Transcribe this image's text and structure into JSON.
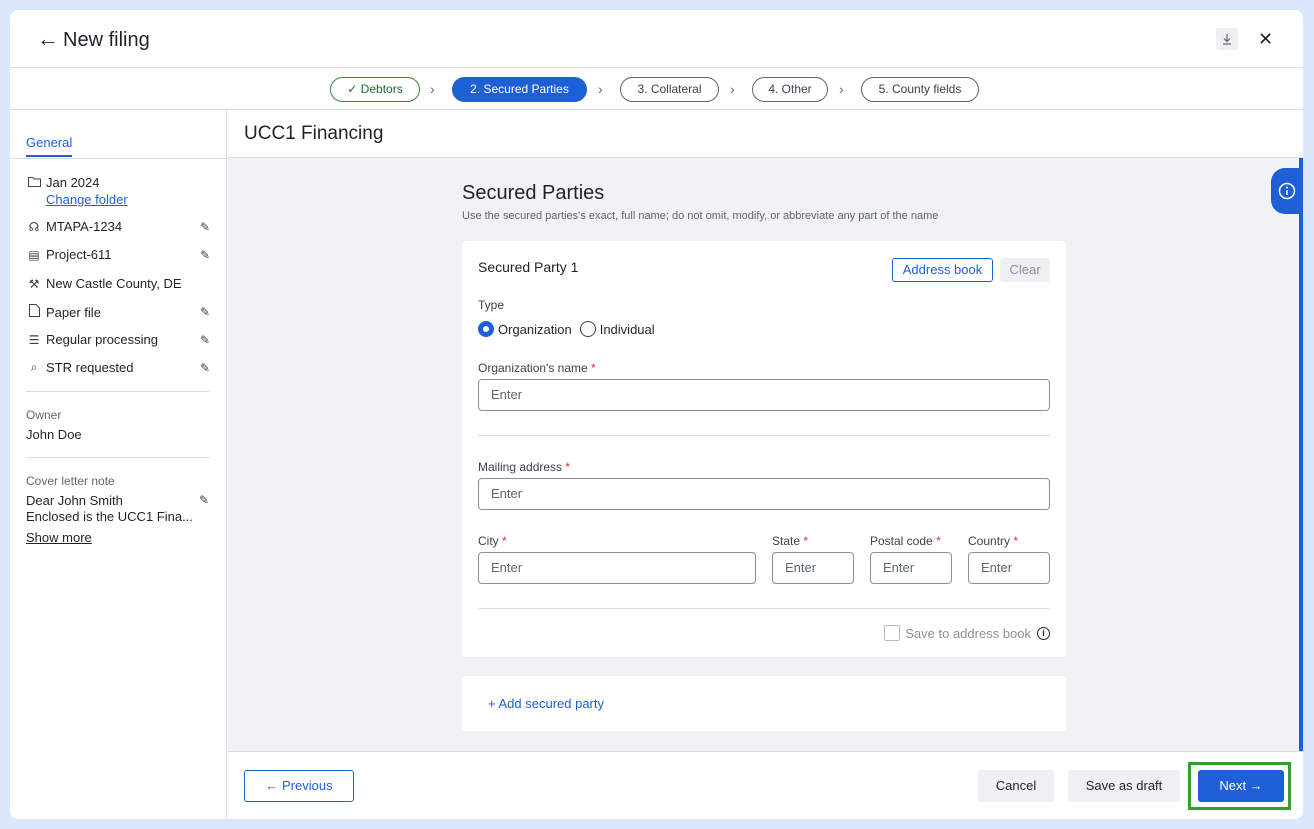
{
  "header": {
    "back_icon": "←",
    "title": "New filing",
    "download_icon": "⤓",
    "close_icon": "✕"
  },
  "stepper": {
    "steps": [
      {
        "label": "✓ Debtors",
        "state": "done"
      },
      {
        "label": "2. Secured Parties",
        "state": "active"
      },
      {
        "label": "3. Collateral",
        "state": "pending"
      },
      {
        "label": "4. Other",
        "state": "pending"
      },
      {
        "label": "5. County fields",
        "state": "pending"
      }
    ],
    "separator": "›"
  },
  "sidebar": {
    "tab": "General",
    "folder": "Jan 2024",
    "change_folder": "Change folder",
    "items": [
      {
        "icon": "headset-icon",
        "label": "MTAPA-1234",
        "editable": true
      },
      {
        "icon": "project-icon",
        "label": "Project-611",
        "editable": true
      },
      {
        "icon": "gavel-icon",
        "label": "New Castle County, DE",
        "editable": false
      },
      {
        "icon": "document-icon",
        "label": "Paper file",
        "editable": true
      },
      {
        "icon": "list-icon",
        "label": "Regular processing",
        "editable": true
      },
      {
        "icon": "search-document-icon",
        "label": "STR requested",
        "editable": true
      }
    ],
    "owner_label": "Owner",
    "owner_value": "John Doe",
    "cover_label": "Cover letter note",
    "cover_line1": "Dear John Smith",
    "cover_line2": "Enclosed is the UCC1 Fina...",
    "show_more": "Show more"
  },
  "main": {
    "title": "UCC1 Financing",
    "section_title": "Secured Parties",
    "section_subtitle": "Use the secured parties's exact, full name; do not omit, modify, or abbreviate any part of the name",
    "card": {
      "title": "Secured Party 1",
      "address_book": "Address book",
      "clear": "Clear",
      "type_label": "Type",
      "type_options": [
        "Organization",
        "Individual"
      ],
      "type_selected": "Organization",
      "org_name_label": "Organization's name",
      "mailing_label": "Mailing address",
      "city_label": "City",
      "state_label": "State",
      "postal_label": "Postal code",
      "country_label": "Country",
      "required_mark": "*",
      "placeholder": "Enter",
      "save_to_address_book": "Save to address book"
    },
    "add_secured_party": "+ Add secured party"
  },
  "footer": {
    "previous": "← Previous",
    "cancel": "Cancel",
    "save_draft": "Save as draft",
    "next": "Next →"
  },
  "colors": {
    "accent": "#1f5fd6",
    "success": "#2e8b3a",
    "highlight": "#3a9a30",
    "required": "#d93025"
  }
}
